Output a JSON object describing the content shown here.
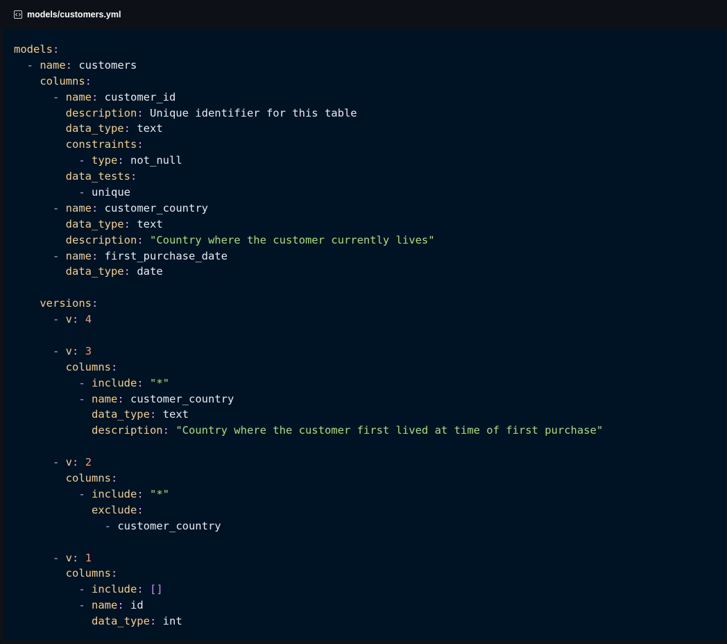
{
  "window": {
    "filename": "models/customers.yml",
    "icon": "code-file-icon"
  },
  "code": {
    "language": "yaml",
    "lines": [
      [
        {
          "t": "k",
          "v": "models"
        },
        {
          "t": "p",
          "v": ":"
        }
      ],
      [
        {
          "t": "ws",
          "v": "  "
        },
        {
          "t": "d",
          "v": "- "
        },
        {
          "t": "k",
          "v": "name"
        },
        {
          "t": "p",
          "v": ": "
        },
        {
          "t": "v",
          "v": "customers"
        }
      ],
      [
        {
          "t": "ws",
          "v": "    "
        },
        {
          "t": "k",
          "v": "columns"
        },
        {
          "t": "p",
          "v": ":"
        }
      ],
      [
        {
          "t": "ws",
          "v": "      "
        },
        {
          "t": "d",
          "v": "- "
        },
        {
          "t": "k",
          "v": "name"
        },
        {
          "t": "p",
          "v": ": "
        },
        {
          "t": "v",
          "v": "customer_id"
        }
      ],
      [
        {
          "t": "ws",
          "v": "        "
        },
        {
          "t": "k",
          "v": "description"
        },
        {
          "t": "p",
          "v": ": "
        },
        {
          "t": "v",
          "v": "Unique identifier for this table"
        }
      ],
      [
        {
          "t": "ws",
          "v": "        "
        },
        {
          "t": "k",
          "v": "data_type"
        },
        {
          "t": "p",
          "v": ": "
        },
        {
          "t": "v",
          "v": "text"
        }
      ],
      [
        {
          "t": "ws",
          "v": "        "
        },
        {
          "t": "k",
          "v": "constraints"
        },
        {
          "t": "p",
          "v": ":"
        }
      ],
      [
        {
          "t": "ws",
          "v": "          "
        },
        {
          "t": "d",
          "v": "- "
        },
        {
          "t": "k",
          "v": "type"
        },
        {
          "t": "p",
          "v": ": "
        },
        {
          "t": "v",
          "v": "not_null"
        }
      ],
      [
        {
          "t": "ws",
          "v": "        "
        },
        {
          "t": "k",
          "v": "data_tests"
        },
        {
          "t": "p",
          "v": ":"
        }
      ],
      [
        {
          "t": "ws",
          "v": "          "
        },
        {
          "t": "d",
          "v": "- "
        },
        {
          "t": "v",
          "v": "unique"
        }
      ],
      [
        {
          "t": "ws",
          "v": "      "
        },
        {
          "t": "d",
          "v": "- "
        },
        {
          "t": "k",
          "v": "name"
        },
        {
          "t": "p",
          "v": ": "
        },
        {
          "t": "v",
          "v": "customer_country"
        }
      ],
      [
        {
          "t": "ws",
          "v": "        "
        },
        {
          "t": "k",
          "v": "data_type"
        },
        {
          "t": "p",
          "v": ": "
        },
        {
          "t": "v",
          "v": "text"
        }
      ],
      [
        {
          "t": "ws",
          "v": "        "
        },
        {
          "t": "k",
          "v": "description"
        },
        {
          "t": "p",
          "v": ": "
        },
        {
          "t": "s",
          "v": "\"Country where the customer currently lives\""
        }
      ],
      [
        {
          "t": "ws",
          "v": "      "
        },
        {
          "t": "d",
          "v": "- "
        },
        {
          "t": "k",
          "v": "name"
        },
        {
          "t": "p",
          "v": ": "
        },
        {
          "t": "v",
          "v": "first_purchase_date"
        }
      ],
      [
        {
          "t": "ws",
          "v": "        "
        },
        {
          "t": "k",
          "v": "data_type"
        },
        {
          "t": "p",
          "v": ": "
        },
        {
          "t": "v",
          "v": "date"
        }
      ],
      [],
      [
        {
          "t": "ws",
          "v": "    "
        },
        {
          "t": "k",
          "v": "versions"
        },
        {
          "t": "p",
          "v": ":"
        }
      ],
      [
        {
          "t": "ws",
          "v": "      "
        },
        {
          "t": "d",
          "v": "- "
        },
        {
          "t": "k",
          "v": "v"
        },
        {
          "t": "p",
          "v": ": "
        },
        {
          "t": "n",
          "v": "4"
        }
      ],
      [],
      [
        {
          "t": "ws",
          "v": "      "
        },
        {
          "t": "d",
          "v": "- "
        },
        {
          "t": "k",
          "v": "v"
        },
        {
          "t": "p",
          "v": ": "
        },
        {
          "t": "n",
          "v": "3"
        }
      ],
      [
        {
          "t": "ws",
          "v": "        "
        },
        {
          "t": "k",
          "v": "columns"
        },
        {
          "t": "p",
          "v": ":"
        }
      ],
      [
        {
          "t": "ws",
          "v": "          "
        },
        {
          "t": "d",
          "v": "- "
        },
        {
          "t": "k",
          "v": "include"
        },
        {
          "t": "p",
          "v": ": "
        },
        {
          "t": "s",
          "v": "\"*\""
        }
      ],
      [
        {
          "t": "ws",
          "v": "          "
        },
        {
          "t": "d",
          "v": "- "
        },
        {
          "t": "k",
          "v": "name"
        },
        {
          "t": "p",
          "v": ": "
        },
        {
          "t": "v",
          "v": "customer_country"
        }
      ],
      [
        {
          "t": "ws",
          "v": "            "
        },
        {
          "t": "k",
          "v": "data_type"
        },
        {
          "t": "p",
          "v": ": "
        },
        {
          "t": "v",
          "v": "text"
        }
      ],
      [
        {
          "t": "ws",
          "v": "            "
        },
        {
          "t": "k",
          "v": "description"
        },
        {
          "t": "p",
          "v": ": "
        },
        {
          "t": "s",
          "v": "\"Country where the customer first lived at time of first purchase\""
        }
      ],
      [],
      [
        {
          "t": "ws",
          "v": "      "
        },
        {
          "t": "d",
          "v": "- "
        },
        {
          "t": "k",
          "v": "v"
        },
        {
          "t": "p",
          "v": ": "
        },
        {
          "t": "n",
          "v": "2"
        }
      ],
      [
        {
          "t": "ws",
          "v": "        "
        },
        {
          "t": "k",
          "v": "columns"
        },
        {
          "t": "p",
          "v": ":"
        }
      ],
      [
        {
          "t": "ws",
          "v": "          "
        },
        {
          "t": "d",
          "v": "- "
        },
        {
          "t": "k",
          "v": "include"
        },
        {
          "t": "p",
          "v": ": "
        },
        {
          "t": "s",
          "v": "\"*\""
        }
      ],
      [
        {
          "t": "ws",
          "v": "            "
        },
        {
          "t": "k",
          "v": "exclude"
        },
        {
          "t": "p",
          "v": ":"
        }
      ],
      [
        {
          "t": "ws",
          "v": "              "
        },
        {
          "t": "d",
          "v": "- "
        },
        {
          "t": "v",
          "v": "customer_country"
        }
      ],
      [],
      [
        {
          "t": "ws",
          "v": "      "
        },
        {
          "t": "d",
          "v": "- "
        },
        {
          "t": "k",
          "v": "v"
        },
        {
          "t": "p",
          "v": ": "
        },
        {
          "t": "n",
          "v": "1"
        }
      ],
      [
        {
          "t": "ws",
          "v": "        "
        },
        {
          "t": "k",
          "v": "columns"
        },
        {
          "t": "p",
          "v": ":"
        }
      ],
      [
        {
          "t": "ws",
          "v": "          "
        },
        {
          "t": "d",
          "v": "- "
        },
        {
          "t": "k",
          "v": "include"
        },
        {
          "t": "p",
          "v": ": "
        },
        {
          "t": "b",
          "v": "[]"
        }
      ],
      [
        {
          "t": "ws",
          "v": "          "
        },
        {
          "t": "d",
          "v": "- "
        },
        {
          "t": "k",
          "v": "name"
        },
        {
          "t": "p",
          "v": ": "
        },
        {
          "t": "v",
          "v": "id"
        }
      ],
      [
        {
          "t": "ws",
          "v": "            "
        },
        {
          "t": "k",
          "v": "data_type"
        },
        {
          "t": "p",
          "v": ": "
        },
        {
          "t": "v",
          "v": "int"
        }
      ]
    ]
  },
  "colors": {
    "background": "#001324",
    "key": "#f5cf8e",
    "string": "#a5e075",
    "number": "#f79a77",
    "dash": "#c9a6f7",
    "text": "#e6edf3"
  }
}
